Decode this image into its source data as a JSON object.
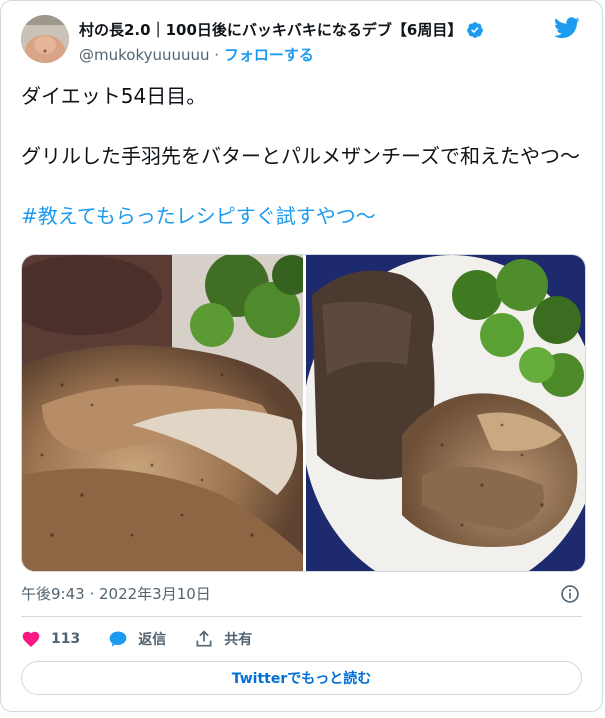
{
  "author": {
    "display_name": "村の長2.0｜100日後にバッキバキになるデブ【6周目】",
    "handle": "@mukokyuuuuuu",
    "separator": " · ",
    "follow_label": "フォローする"
  },
  "tweet": {
    "line1": "ダイエット54日目。",
    "line2": "グリルした手羽先をバターとパルメザンチーズで和えたやつ〜",
    "hashtag": "#教えてもらったレシピすぐ試すやつ〜"
  },
  "meta": {
    "timestamp": "午後9:43 · 2022年3月10日"
  },
  "actions": {
    "likes_count": "113",
    "reply_label": "返信",
    "share_label": "共有"
  },
  "read_more_label": "Twitterでもっと読む",
  "colors": {
    "accent": "#1d9bf0",
    "like": "#f91880",
    "text": "#0f1419",
    "muted": "#536471",
    "border": "#cfd9de"
  },
  "icons": [
    "avatar-photo",
    "verified-badge-icon",
    "twitter-bird-icon",
    "info-icon",
    "heart-icon",
    "reply-bubble-icon",
    "share-icon"
  ]
}
